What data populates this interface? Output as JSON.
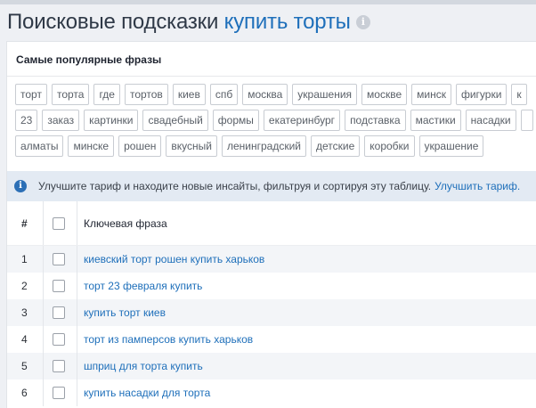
{
  "header": {
    "title_prefix": "Поисковые подсказки",
    "keyword": "купить торты",
    "info_glyph": "i"
  },
  "popular": {
    "title": "Самые популярные фразы",
    "rows": [
      [
        "торт",
        "торта",
        "где",
        "тортов",
        "киев",
        "спб",
        "москва",
        "украшения",
        "москве",
        "минск",
        "фигурки",
        "к"
      ],
      [
        "23",
        "заказ",
        "картинки",
        "свадебный",
        "формы",
        "екатеринбург",
        "подставка",
        "мастики",
        "насадки",
        ""
      ],
      [
        "алматы",
        "минске",
        "рошен",
        "вкусный",
        "ленинградский",
        "детские",
        "коробки",
        "украшение"
      ]
    ]
  },
  "notice": {
    "icon": "i",
    "text": "Улучшите тариф и находите новые инсайты, фильтруя и сортируя эту таблицу.",
    "link": "Улучшить тариф."
  },
  "table": {
    "col_num": "#",
    "col_phrase": "Ключевая фраза",
    "rows": [
      {
        "n": "1",
        "phrase": "киевский торт рошен купить харьков"
      },
      {
        "n": "2",
        "phrase": "торт 23 февраля купить"
      },
      {
        "n": "3",
        "phrase": "купить торт киев"
      },
      {
        "n": "4",
        "phrase": "торт из памперсов купить харьков"
      },
      {
        "n": "5",
        "phrase": "шприц для торта купить"
      },
      {
        "n": "6",
        "phrase": "купить насадки для торта"
      }
    ]
  },
  "colors": {
    "accent": "#1e6fba",
    "notice_bg": "#e3eaf3",
    "row_alt": "#f3f5f8"
  }
}
